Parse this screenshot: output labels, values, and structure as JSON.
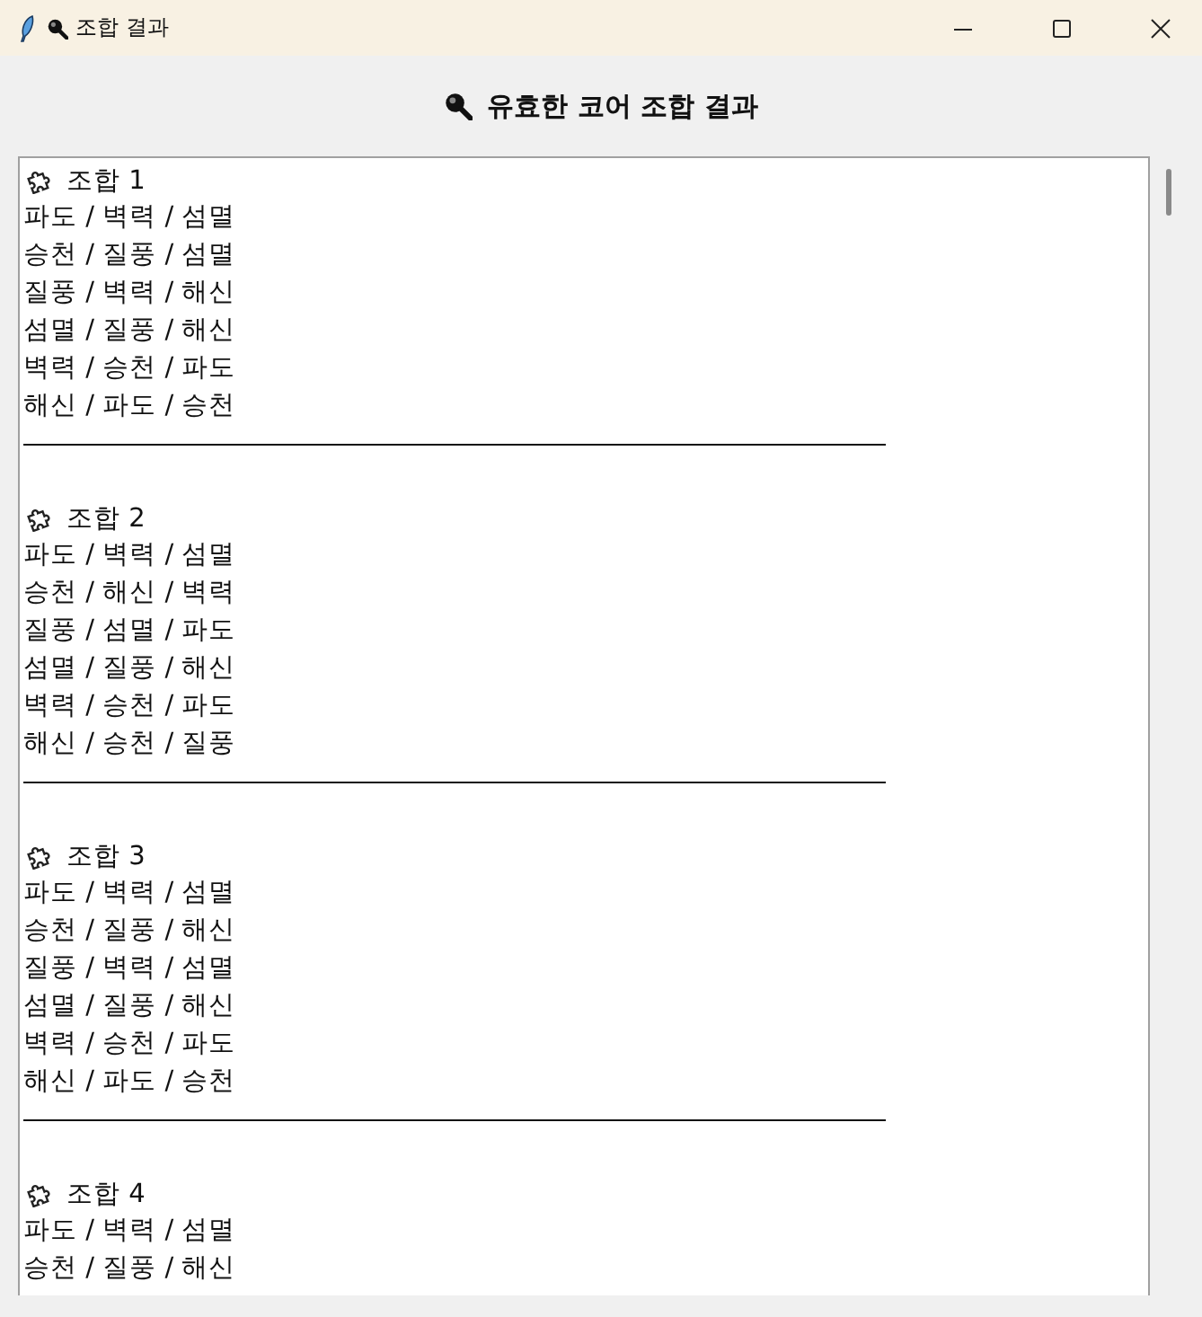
{
  "window": {
    "title": "조합 결과"
  },
  "heading": "유효한 코어 조합 결과",
  "combinations": [
    {
      "title": "조합 1",
      "lines": [
        "파도 / 벽력 / 섬멸",
        "승천 / 질풍 / 섬멸",
        "질풍 / 벽력 / 해신",
        "섬멸 / 질풍 / 해신",
        "벽력 / 승천 / 파도",
        "해신 / 파도 / 승천"
      ]
    },
    {
      "title": "조합 2",
      "lines": [
        "파도 / 벽력 / 섬멸",
        "승천 / 해신 / 벽력",
        "질풍 / 섬멸 / 파도",
        "섬멸 / 질풍 / 해신",
        "벽력 / 승천 / 파도",
        "해신 / 승천 / 질풍"
      ]
    },
    {
      "title": "조합 3",
      "lines": [
        "파도 / 벽력 / 섬멸",
        "승천 / 질풍 / 해신",
        "질풍 / 벽력 / 섬멸",
        "섬멸 / 질풍 / 해신",
        "벽력 / 승천 / 파도",
        "해신 / 파도 / 승천"
      ]
    },
    {
      "title": "조합 4",
      "lines": [
        "파도 / 벽력 / 섬멸",
        "승천 / 질풍 / 해신"
      ]
    }
  ]
}
